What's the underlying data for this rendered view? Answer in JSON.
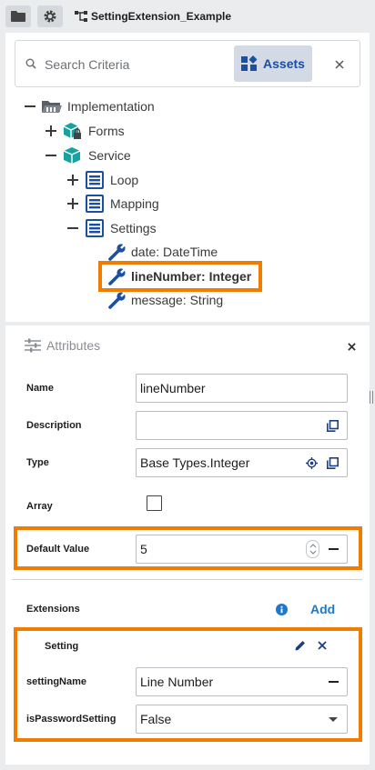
{
  "topbar": {
    "folder_icon": "folder-icon",
    "settings_icon": "gear-icon",
    "project_title": "SettingExtension_Example"
  },
  "search": {
    "placeholder": "Search Criteria",
    "assets_label": "Assets"
  },
  "tree": {
    "implementation": "Implementation",
    "forms": "Forms",
    "service": "Service",
    "loop": "Loop",
    "mapping": "Mapping",
    "settings": "Settings",
    "date": "date: DateTime",
    "line_number": "lineNumber: Integer",
    "message": "message: String"
  },
  "attributes": {
    "title": "Attributes",
    "name_label": "Name",
    "name_value": "lineNumber",
    "description_label": "Description",
    "description_value": "",
    "type_label": "Type",
    "type_value": "Base Types.Integer",
    "array_label": "Array",
    "array_checked": false,
    "default_label": "Default Value",
    "default_value": "5",
    "extensions_label": "Extensions",
    "add_label": "Add"
  },
  "extension": {
    "title": "Setting",
    "setting_name_label": "settingName",
    "setting_name_value": "Line Number",
    "is_password_label": "isPasswordSetting",
    "is_password_value": "False"
  },
  "colors": {
    "highlight": "#f07d00",
    "accent_blue": "#1b4fa0",
    "teal": "#17a2a0"
  }
}
